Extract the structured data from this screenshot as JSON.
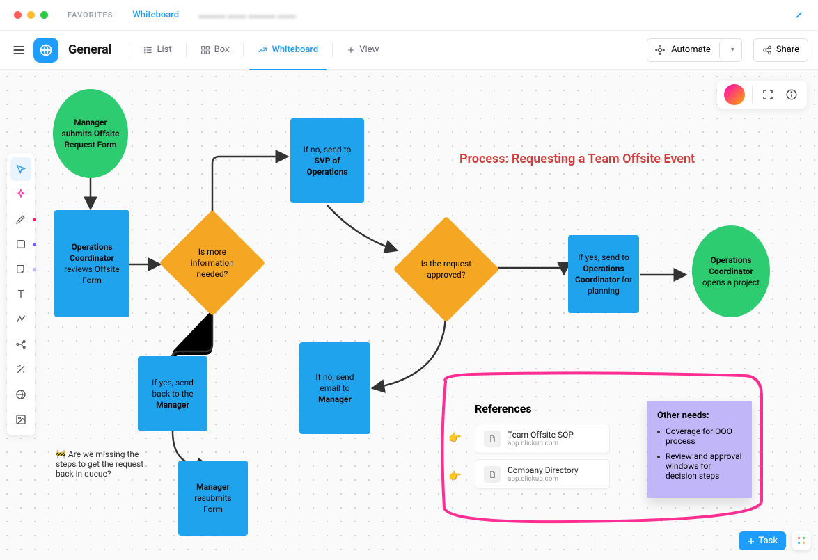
{
  "mac": {
    "favorites": "FAVORITES",
    "tab1": "Whiteboard",
    "tab2": ""
  },
  "toolbar": {
    "space_name": "General",
    "views": {
      "list": "List",
      "box": "Box",
      "whiteboard": "Whiteboard",
      "add": "View"
    },
    "automate": "Automate",
    "share": "Share"
  },
  "title": "Process: Requesting a Team Offsite Event",
  "nodes": {
    "start": "Manager submits Offsite Request Form",
    "review": {
      "line1": "Operations Coordinator",
      "line2": "reviews Offsite Form"
    },
    "decision1": "Is more information needed?",
    "svp": {
      "line1": "If no, send to",
      "line2": "SVP of Operations"
    },
    "sendback": {
      "line1": "If yes, send back to the",
      "line2": "Manager"
    },
    "resubmit": {
      "line1": "Manager",
      "line2": "resubmits Form"
    },
    "decision2": "Is the request approved?",
    "noemail": {
      "line1": "If no, send email to",
      "line2": "Manager"
    },
    "yescoord": {
      "line1": "If yes, send to",
      "line2": "Operations Coordinator",
      "line3": "for planning"
    },
    "end": {
      "line1": "Operations Coordinator",
      "line2": "opens a project"
    }
  },
  "comment": "🚧 Are we missing the steps to get the request back in queue?",
  "references": {
    "title": "References",
    "items": [
      {
        "title": "Team Offsite SOP",
        "sub": "app.clickup.com"
      },
      {
        "title": "Company Directory",
        "sub": "app.clickup.com"
      }
    ],
    "pointer": "👉"
  },
  "sticky": {
    "heading": "Other needs:",
    "items": [
      "Coverage for OOO process",
      "Review and approval windows for decision steps"
    ]
  },
  "task_btn": "Task"
}
